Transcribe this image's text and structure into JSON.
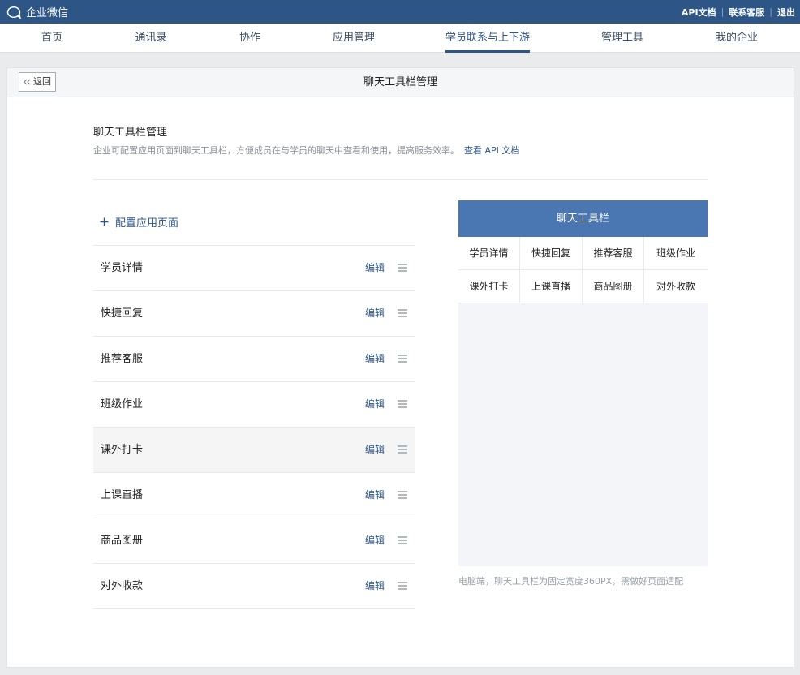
{
  "topbar": {
    "logo_text": "企业微信",
    "links": [
      "API文档",
      "联系客服",
      "退出"
    ],
    "colors": {
      "bg": "#2d5586"
    }
  },
  "nav": {
    "items": [
      "首页",
      "通讯录",
      "协作",
      "应用管理",
      "学员联系与上下游",
      "管理工具",
      "我的企业"
    ],
    "active": "学员联系与上下游"
  },
  "page": {
    "back_label": "返回",
    "title": "聊天工具栏管理"
  },
  "intro": {
    "title": "聊天工具栏管理",
    "desc": "企业可配置应用页面到聊天工具栏，方便成员在与学员的聊天中查看和使用，提高服务效率。",
    "api_link": "查看 API 文档"
  },
  "config": {
    "add_label": "配置应用页面",
    "edit_label": "编辑",
    "items": [
      "学员详情",
      "快捷回复",
      "推荐客服",
      "班级作业",
      "课外打卡",
      "上课直播",
      "商品图册",
      "对外收款"
    ],
    "highlighted_item": "课外打卡"
  },
  "preview": {
    "title": "聊天工具栏",
    "items": [
      "学员详情",
      "快捷回复",
      "推荐客服",
      "班级作业",
      "课外打卡",
      "上课直播",
      "商品图册",
      "对外收款"
    ],
    "footnote": "电脑端，聊天工具栏为固定宽度360PX，需做好页面适配",
    "colors": {
      "header": "#4a77b1"
    }
  }
}
